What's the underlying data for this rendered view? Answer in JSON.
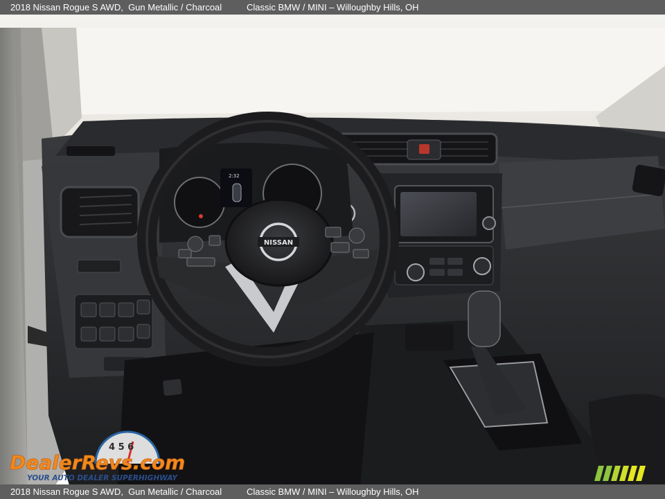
{
  "header": {
    "vehicle": "2018 Nissan Rogue S AWD,",
    "color": "Gun Metallic / Charcoal",
    "dealer": "Classic BMW / MINI – Willoughby Hills, OH"
  },
  "footer": {
    "vehicle": "2018 Nissan Rogue S AWD,",
    "color": "Gun Metallic / Charcoal",
    "dealer": "Classic BMW / MINI – Willoughby Hills, OH"
  },
  "photo": {
    "subject": "dashboard-interior",
    "steering_badge": "NISSAN",
    "cluster_time": "2:32"
  },
  "watermark": {
    "brand": "DealerRevs.com",
    "tagline": "YOUR AUTO DEALER SUPERHIGHWAY",
    "gauge_digits": "4 5 6",
    "colors": {
      "brand_red": "#d9302a",
      "brand_orange": "#f08a1d",
      "brand_blue": "#2b6db3",
      "stripe_green": "#8cc63f",
      "stripe_yellow": "#e6e621"
    }
  }
}
